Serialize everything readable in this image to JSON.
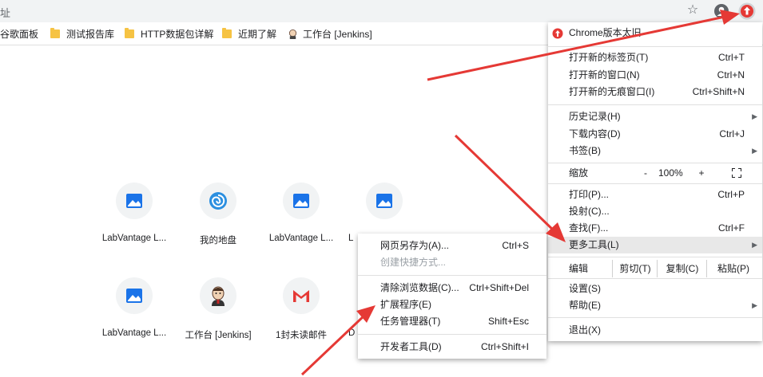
{
  "omnibox": {
    "text": "址"
  },
  "bookmarks": [
    {
      "label": "谷歌面板",
      "icon": "none"
    },
    {
      "label": "测试报告库",
      "icon": "folder-icon"
    },
    {
      "label": "HTTP数据包详解",
      "icon": "folder-icon"
    },
    {
      "label": "近期了解",
      "icon": "folder-icon"
    },
    {
      "label": "工作台 [Jenkins]",
      "icon": "jenkins-icon"
    }
  ],
  "shortcuts": [
    {
      "label": "LabVantage L...",
      "icon": "image-icon"
    },
    {
      "label": "我的地盘",
      "icon": "spiral-icon"
    },
    {
      "label": "LabVantage L...",
      "icon": "image-icon"
    },
    {
      "label": "L",
      "icon": "image-icon"
    },
    {
      "label": "LabVantage L...",
      "icon": "image-icon"
    },
    {
      "label": "工作台 [Jenkins]",
      "icon": "jenkins-icon"
    },
    {
      "label": "1封未读邮件",
      "icon": "gmail-icon"
    },
    {
      "label": "D",
      "icon": "image-icon"
    }
  ],
  "menu": {
    "update": "Chrome版本太旧",
    "new_tab": {
      "label": "打开新的标签页(T)",
      "shortcut": "Ctrl+T"
    },
    "new_window": {
      "label": "打开新的窗口(N)",
      "shortcut": "Ctrl+N"
    },
    "incognito": {
      "label": "打开新的无痕窗口(I)",
      "shortcut": "Ctrl+Shift+N"
    },
    "history": "历史记录(H)",
    "downloads": {
      "label": "下载内容(D)",
      "shortcut": "Ctrl+J"
    },
    "bookmarks": "书签(B)",
    "zoom": {
      "label": "缩放",
      "minus": "-",
      "value": "100%",
      "plus": "+"
    },
    "print": {
      "label": "打印(P)...",
      "shortcut": "Ctrl+P"
    },
    "cast": "投射(C)...",
    "find": {
      "label": "查找(F)...",
      "shortcut": "Ctrl+F"
    },
    "more_tools": "更多工具(L)",
    "edit": {
      "label": "编辑",
      "cut": "剪切(T)",
      "copy": "复制(C)",
      "paste": "粘贴(P)"
    },
    "settings": "设置(S)",
    "help": "帮助(E)",
    "exit": "退出(X)"
  },
  "submenu": {
    "save_page": {
      "label": "网页另存为(A)...",
      "shortcut": "Ctrl+S"
    },
    "create_shortcut": "创建快捷方式...",
    "clear_data": {
      "label": "清除浏览数据(C)...",
      "shortcut": "Ctrl+Shift+Del"
    },
    "extensions": "扩展程序(E)",
    "task_manager": {
      "label": "任务管理器(T)",
      "shortcut": "Shift+Esc"
    },
    "dev_tools": {
      "label": "开发者工具(D)",
      "shortcut": "Ctrl+Shift+I"
    }
  },
  "colors": {
    "accent_red": "#e53935",
    "menu_highlight": "#e8e8e8",
    "toolbar": "#f1f3f4"
  }
}
